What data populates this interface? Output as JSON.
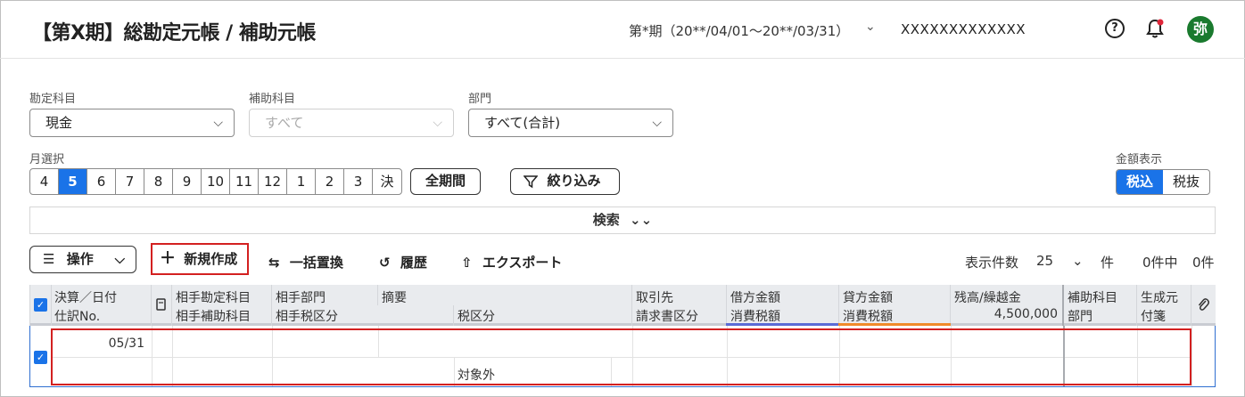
{
  "header": {
    "title": "【第X期】総勘定元帳 / 補助元帳",
    "period": "第*期（20**/04/01〜20**/03/31）",
    "company": "XXXXXXXXXXXXX",
    "avatar": "弥",
    "help_glyph": "?"
  },
  "filters": {
    "account_label": "勘定科目",
    "account_value": "現金",
    "sub_account_label": "補助科目",
    "sub_account_value": "すべて",
    "dept_label": "部門",
    "dept_value": "すべて(合計)",
    "month_label": "月選択",
    "months": [
      "4",
      "5",
      "6",
      "7",
      "8",
      "9",
      "10",
      "11",
      "12",
      "1",
      "2",
      "3",
      "決"
    ],
    "selected_month": "5",
    "all_period": "全期間",
    "narrow": "絞り込み",
    "amount_label": "金額表示",
    "tax_in": "税込",
    "tax_out": "税抜",
    "search": "検索"
  },
  "toolbar": {
    "operation": "操作",
    "new": "新規作成",
    "replace": "一括置換",
    "history": "履歴",
    "export": "エクスポート",
    "display_count_label": "表示件数",
    "display_count": "25",
    "unit": "件",
    "total": "0件中",
    "shown": "0件"
  },
  "table": {
    "headers_top": [
      "決算／日付",
      "相手勘定科目",
      "相手部門",
      "摘要",
      "取引先",
      "借方金額",
      "貸方金額",
      "残高/繰越金",
      "補助科目",
      "生成元"
    ],
    "headers_bottom": [
      "仕訳No.",
      "相手補助科目",
      "相手税区分",
      "税区分",
      "請求書区分",
      "消費税額",
      "消費税額",
      "4,500,000",
      "部門",
      "付箋"
    ],
    "row": {
      "date": "05/31",
      "tax_class": "対象外"
    }
  },
  "colors": {
    "accent": "#1a73e8",
    "highlight": "#d32020",
    "avatar": "#1a7a2e"
  }
}
